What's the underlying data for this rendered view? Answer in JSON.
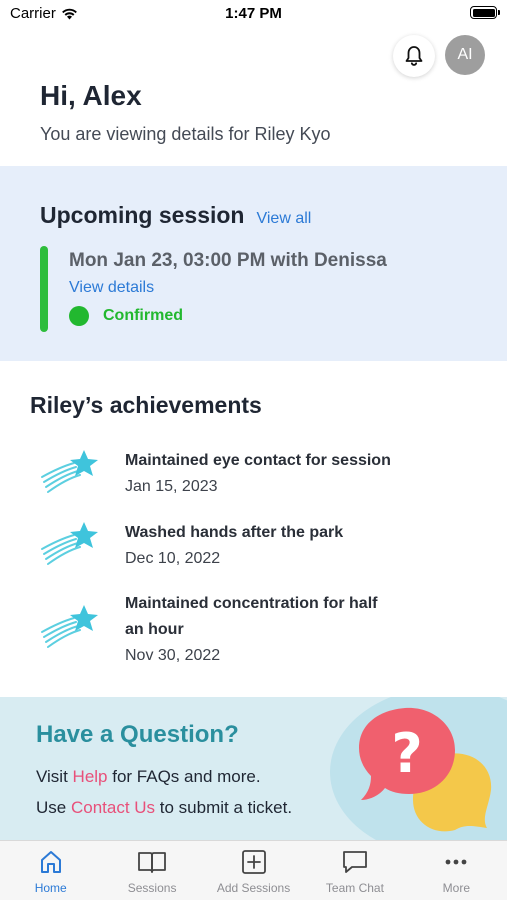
{
  "status_bar": {
    "carrier": "Carrier",
    "time": "1:47 PM"
  },
  "header": {
    "avatar_initials": "AI"
  },
  "greeting": {
    "title": "Hi, Alex",
    "subtitle": "You are viewing details for Riley Kyo"
  },
  "upcoming": {
    "title": "Upcoming session",
    "view_all": "View all",
    "session_text": "Mon Jan 23, 03:00 PM with Denissa",
    "view_details": "View details",
    "status": "Confirmed",
    "accent_color": "#2ebd3c"
  },
  "achievements": {
    "title": "Riley’s achievements",
    "items": [
      {
        "title": "Maintained eye contact for session",
        "date": "Jan 15, 2023",
        "icon": "shooting-star-icon"
      },
      {
        "title": "Washed hands after the park",
        "date": "Dec 10, 2022",
        "icon": "shooting-star-icon"
      },
      {
        "title": "Maintained concentration for half an hour",
        "date": "Nov 30, 2022",
        "icon": "shooting-star-icon"
      }
    ]
  },
  "question": {
    "title": "Have a Question?",
    "line1_pre": "Visit ",
    "line1_link": "Help",
    "line1_post": " for FAQs and more.",
    "line2_pre": "Use ",
    "line2_link": "Contact Us",
    "line2_post": " to submit a ticket."
  },
  "tabs": [
    {
      "label": "Home",
      "icon": "home-icon",
      "active": true
    },
    {
      "label": "Sessions",
      "icon": "book-icon",
      "active": false
    },
    {
      "label": "Add Sessions",
      "icon": "plus-square-icon",
      "active": false
    },
    {
      "label": "Team Chat",
      "icon": "chat-icon",
      "active": false
    },
    {
      "label": "More",
      "icon": "more-icon",
      "active": false
    }
  ]
}
